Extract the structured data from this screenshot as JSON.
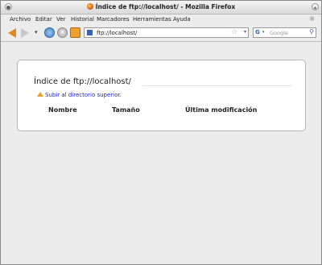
{
  "window": {
    "title": "Índice de ftp://localhost/ - Mozilla Firefox"
  },
  "menubar": {
    "items": [
      "Archivo",
      "Editar",
      "Ver",
      "Historial",
      "Marcadores",
      "Herramientas",
      "Ayuda"
    ]
  },
  "navbar": {
    "url": "ftp://localhost/",
    "search_placeholder": "Google"
  },
  "page": {
    "title": "Índice de ftp://localhost/",
    "parent_link": "Subir al directorio superior.",
    "columns": [
      "Nombre",
      "Tamaño",
      "Última modificación"
    ]
  }
}
